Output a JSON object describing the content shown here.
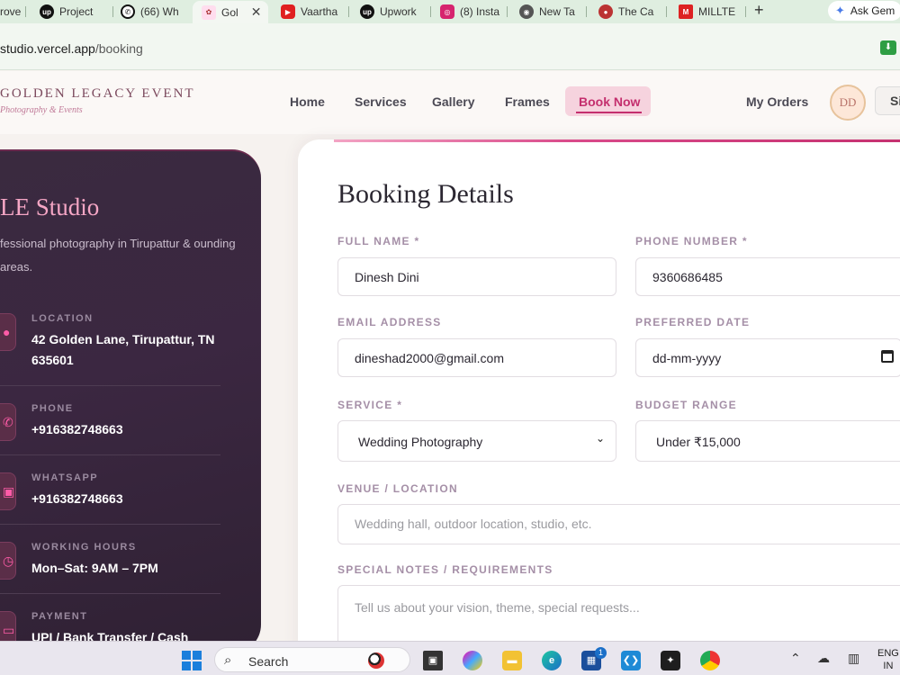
{
  "browser": {
    "tabs": [
      {
        "label": "rove",
        "icon": "partial-tab-icon"
      },
      {
        "label": "Project",
        "icon": "upwork-icon"
      },
      {
        "label": "(66) Wh",
        "icon": "whatsapp-icon"
      },
      {
        "label": "Gol",
        "icon": "golden-legacy-favicon",
        "active": true
      },
      {
        "label": "Vaartha",
        "icon": "youtube-icon"
      },
      {
        "label": "Upwork",
        "icon": "upwork-icon"
      },
      {
        "label": "(8) Insta",
        "icon": "instagram-icon"
      },
      {
        "label": "New Ta",
        "icon": "chrome-icon"
      },
      {
        "label": "The Ca",
        "icon": "car-icon"
      },
      {
        "label": "MILLTE",
        "icon": "millte-icon"
      }
    ],
    "new_tab": "+",
    "ask_gemini": "Ask Gem",
    "url_host": "studio.vercel.app",
    "url_path": "/booking"
  },
  "header": {
    "brand": "GOLDEN LEGACY EVENT",
    "tagline": "Photography & Events",
    "nav": [
      "Home",
      "Services",
      "Gallery",
      "Frames"
    ],
    "book_now": "Book Now",
    "my_orders": "My Orders",
    "avatar_initials": "DD",
    "signin_partial": "Si"
  },
  "studio": {
    "title": "LE Studio",
    "description": "fessional photography in Tirupattur & ounding areas.",
    "contacts": [
      {
        "label": "LOCATION",
        "value": "42 Golden Lane, Tirupattur, TN 635601",
        "icon": "location-pin-icon"
      },
      {
        "label": "PHONE",
        "value": "+916382748663",
        "icon": "phone-icon"
      },
      {
        "label": "WHATSAPP",
        "value": "+916382748663",
        "icon": "whatsapp-icon"
      },
      {
        "label": "WORKING HOURS",
        "value": "Mon–Sat: 9AM – 7PM",
        "icon": "clock-icon"
      },
      {
        "label": "PAYMENT",
        "value": "UPI / Bank Transfer / Cash",
        "icon": "card-icon"
      }
    ]
  },
  "form": {
    "title": "Booking Details",
    "full_name": {
      "label": "FULL NAME *",
      "value": "Dinesh Dini"
    },
    "phone": {
      "label": "PHONE NUMBER *",
      "value": "9360686485"
    },
    "email": {
      "label": "EMAIL ADDRESS",
      "value": "dineshad2000@gmail.com"
    },
    "date": {
      "label": "PREFERRED DATE",
      "value": "dd-mm-yyyy"
    },
    "service": {
      "label": "SERVICE *",
      "value": "Wedding Photography"
    },
    "budget": {
      "label": "BUDGET RANGE",
      "value": "Under ₹15,000"
    },
    "venue": {
      "label": "VENUE / LOCATION",
      "placeholder": "Wedding hall, outdoor location, studio, etc."
    },
    "notes": {
      "label": "SPECIAL NOTES / REQUIREMENTS",
      "placeholder": "Tell us about your vision, theme, special requests..."
    }
  },
  "taskbar": {
    "search": "Search",
    "lang_line1": "ENG",
    "lang_line2": "IN",
    "store_badge": "1"
  },
  "colors": {
    "accent": "#c42f6e",
    "card_dark": "#3a2a3f",
    "pink_title": "#f5a6c5"
  }
}
